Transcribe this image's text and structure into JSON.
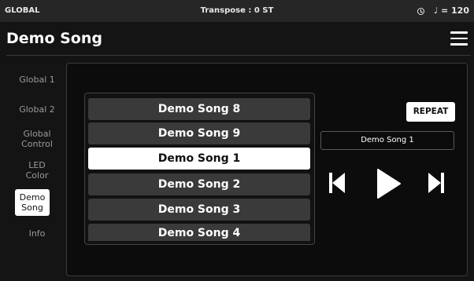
{
  "status_bar": {
    "left": "GLOBAL",
    "center": "Transpose : 0 ST",
    "tempo": "♩ = 120"
  },
  "header": {
    "title": "Demo Song"
  },
  "sidebar": {
    "items": [
      {
        "label": "Global 1"
      },
      {
        "label": "Global 2"
      },
      {
        "label": "Global Control"
      },
      {
        "label": "LED Color"
      },
      {
        "label": "Demo Song"
      },
      {
        "label": "Info"
      }
    ],
    "active_item": "Demo Song"
  },
  "song_list": {
    "items": [
      {
        "label": "Demo Song  8"
      },
      {
        "label": "Demo Song  9"
      },
      {
        "label": "Demo Song 1"
      },
      {
        "label": "Demo Song 2"
      },
      {
        "label": "Demo Song 3"
      },
      {
        "label": "Demo Song 4"
      }
    ],
    "selected": "Demo Song 1"
  },
  "controls": {
    "repeat_label": "REPEAT",
    "current_song": "Demo Song 1"
  },
  "icons": {
    "status": [
      "clock-icon"
    ],
    "header": [
      "hamburger-menu-icon"
    ],
    "transport": [
      "previous-icon",
      "play-icon",
      "next-icon"
    ]
  },
  "colors": {
    "background": "#141414",
    "status_bar": "#262626",
    "row": "#3a3a3a",
    "selected": "#ffffff"
  }
}
